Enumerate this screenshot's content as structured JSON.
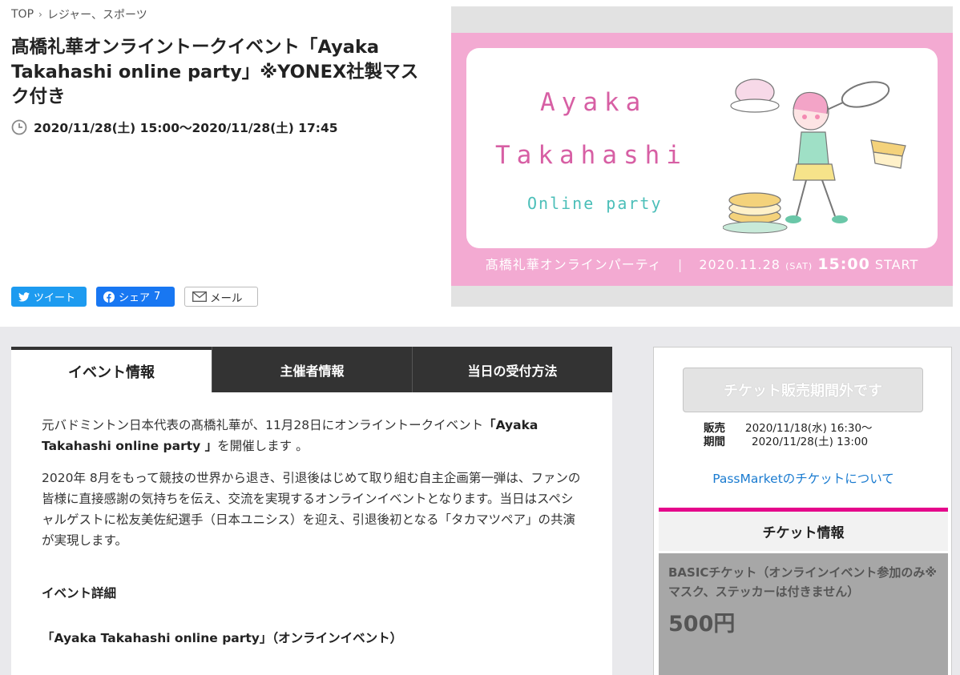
{
  "breadcrumb": {
    "home": "TOP",
    "category": "レジャー、スポーツ"
  },
  "event": {
    "title": "髙橋礼華オンライントークイベント「Ayaka Takahashi online party」※YONEX社製マスク付き",
    "datetime": "2020/11/28(土) 15:00〜2020/11/28(土) 17:45"
  },
  "share": {
    "tweet": "ツイート",
    "facebook": "シェア",
    "facebook_count": "7",
    "mail": "メール"
  },
  "banner": {
    "line1": "Ayaka",
    "line2": "Takahashi",
    "line3": "Online party",
    "footer_jp": "髙橋礼華オンラインパーティ",
    "footer_date": "2020.11.28",
    "footer_day": "(SAT)",
    "footer_time": "15:00",
    "footer_start": "START"
  },
  "tabs": [
    "イベント情報",
    "主催者情報",
    "当日の受付方法"
  ],
  "content": {
    "p1_a": "元バドミントン日本代表の髙橋礼華が、11月28日にオンライントークイベント",
    "p1_b": "「Ayaka Takahashi online party 」",
    "p1_c": "を開催します 。",
    "p2": "2020年 8月をもって競技の世界から退き、引退後はじめて取り組む自主企画第一弾は、ファンの皆様に直接感謝の気持ちを伝え、交流を実現するオンラインイベントとなります。当日はスペシャルゲストに松友美佐紀選手（日本ユニシス）を迎え、引退後初となる「タカマツペア」の共演が実現します。",
    "heading": "イベント詳細",
    "sub": "「Ayaka Takahashi online party」（オンラインイベント）"
  },
  "sidebar": {
    "sold_button": "チケット販売期間外です",
    "period_label_1": "販売",
    "period_label_2": "期間",
    "period_start": "2020/11/18(水) 16:30〜",
    "period_end": "2020/11/28(土) 13:00",
    "pass_link": "PassMarketのチケットについて",
    "ticket_heading": "チケット情報",
    "ticket_name": "BASICチケット（オンラインイベント参加のみ※マスク、ステッカーは付きません）",
    "ticket_price": "500円"
  },
  "colors": {
    "accent_pink": "#e5068b",
    "link_blue": "#1a7bd0",
    "banner_pink": "#f3aad2",
    "twitter": "#1d9bf0",
    "facebook": "#1877f2"
  }
}
